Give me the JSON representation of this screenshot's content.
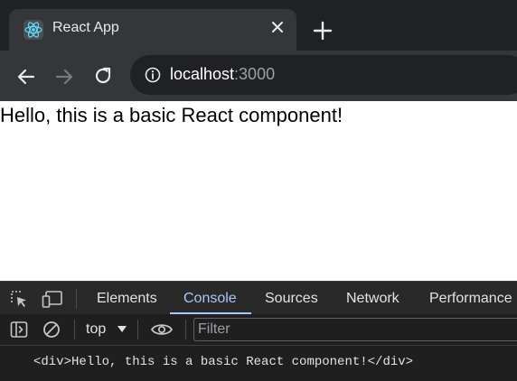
{
  "browser": {
    "tab": {
      "title": "React App"
    },
    "omnibox": {
      "host": "localhost",
      "port": ":3000"
    }
  },
  "page": {
    "text": "Hello, this is a basic React component!"
  },
  "devtools": {
    "tabs": [
      "Elements",
      "Console",
      "Sources",
      "Network",
      "Performance"
    ],
    "active_tab": "Console",
    "context": "top",
    "filter_placeholder": "Filter",
    "console_lines": [
      "<div>Hello, this is a basic React component!</div>"
    ]
  },
  "colors": {
    "accent": "#a8c7fa"
  }
}
